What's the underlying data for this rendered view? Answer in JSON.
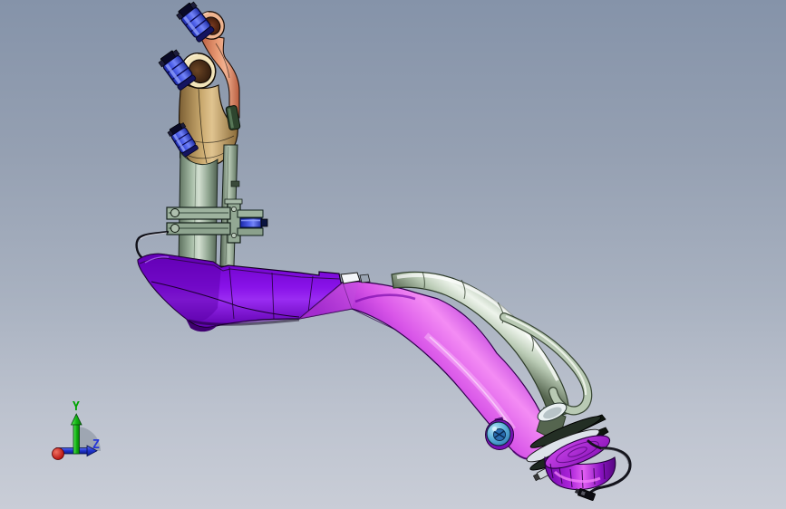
{
  "viewport": {
    "type_label": "3D CAD viewport",
    "background_top": "#8593a9",
    "background_bottom": "#c9cdd7"
  },
  "axis_triad": {
    "y_label": "Y",
    "z_label": "Z",
    "y_color": "#00a400",
    "z_color": "#2637d8",
    "x_ball_color": "#cc1414",
    "sector_color": "#99a1ad"
  },
  "parts": {
    "vent_hose_color": "#e0916c",
    "filler_hose_color": "#cbab70",
    "hose_clamp_color": "#3346dd",
    "neck_pipe_color": "#a9bfa9",
    "vent_line_color": "#9cb29c",
    "bracket_color": "#9db29e",
    "bracket_stud_color": "#3a4ee8",
    "heat_shield_upper_color": "#8812e8",
    "heat_shield_lower_color": "#e06cf0",
    "filler_tube_color": "#d5e2d2",
    "shield_tab_color": "#f4f6fa",
    "grommet_color": "#55aede",
    "flange_ring_color": "#232e24",
    "seal_ring_color": "#dde2e9",
    "fuel_cap_color": "#b62ade",
    "tether_color": "#14141c"
  }
}
